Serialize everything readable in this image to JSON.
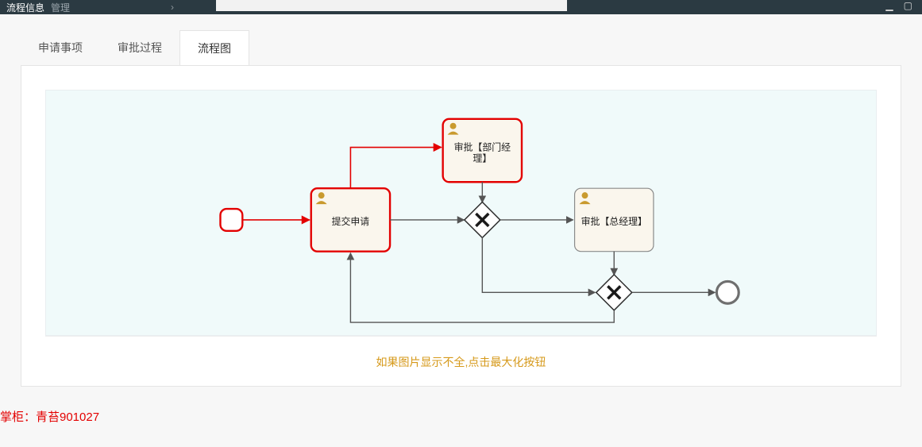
{
  "topbar": {
    "title": "流程信息",
    "subtitle": "管理",
    "arrow": "›"
  },
  "tabs": {
    "items": [
      {
        "label": "申请事项"
      },
      {
        "label": "审批过程"
      },
      {
        "label": "流程图"
      }
    ],
    "active_index": 2
  },
  "diagram": {
    "nodes": {
      "start": {
        "type": "startEvent",
        "highlighted": true
      },
      "submit": {
        "type": "userTask",
        "label": "提交申请",
        "highlighted": true
      },
      "dept": {
        "type": "userTask",
        "label_line1": "审批【部门经",
        "label_line2": "理】",
        "highlighted": true
      },
      "gw1": {
        "type": "exclusiveGateway"
      },
      "gm": {
        "type": "userTask",
        "label": "审批【总经理】",
        "highlighted": false
      },
      "gw2": {
        "type": "exclusiveGateway"
      },
      "end": {
        "type": "endEvent"
      }
    },
    "edges": [
      {
        "from": "start",
        "to": "submit",
        "highlighted": true
      },
      {
        "from": "submit",
        "to": "dept",
        "highlighted": true,
        "routing": "up"
      },
      {
        "from": "dept",
        "to": "gw1"
      },
      {
        "from": "submit",
        "to": "gw1"
      },
      {
        "from": "gw1",
        "to": "gm"
      },
      {
        "from": "gm",
        "to": "gw2",
        "routing": "down"
      },
      {
        "from": "gw1",
        "to": "gw2",
        "routing": "down-skip"
      },
      {
        "from": "gw2",
        "to": "end"
      },
      {
        "from": "gw2",
        "to": "submit",
        "routing": "loop-bottom"
      }
    ]
  },
  "hint": "如果图片显示不全,点击最大化按钮",
  "watermark": "掌柜：青苔901027"
}
